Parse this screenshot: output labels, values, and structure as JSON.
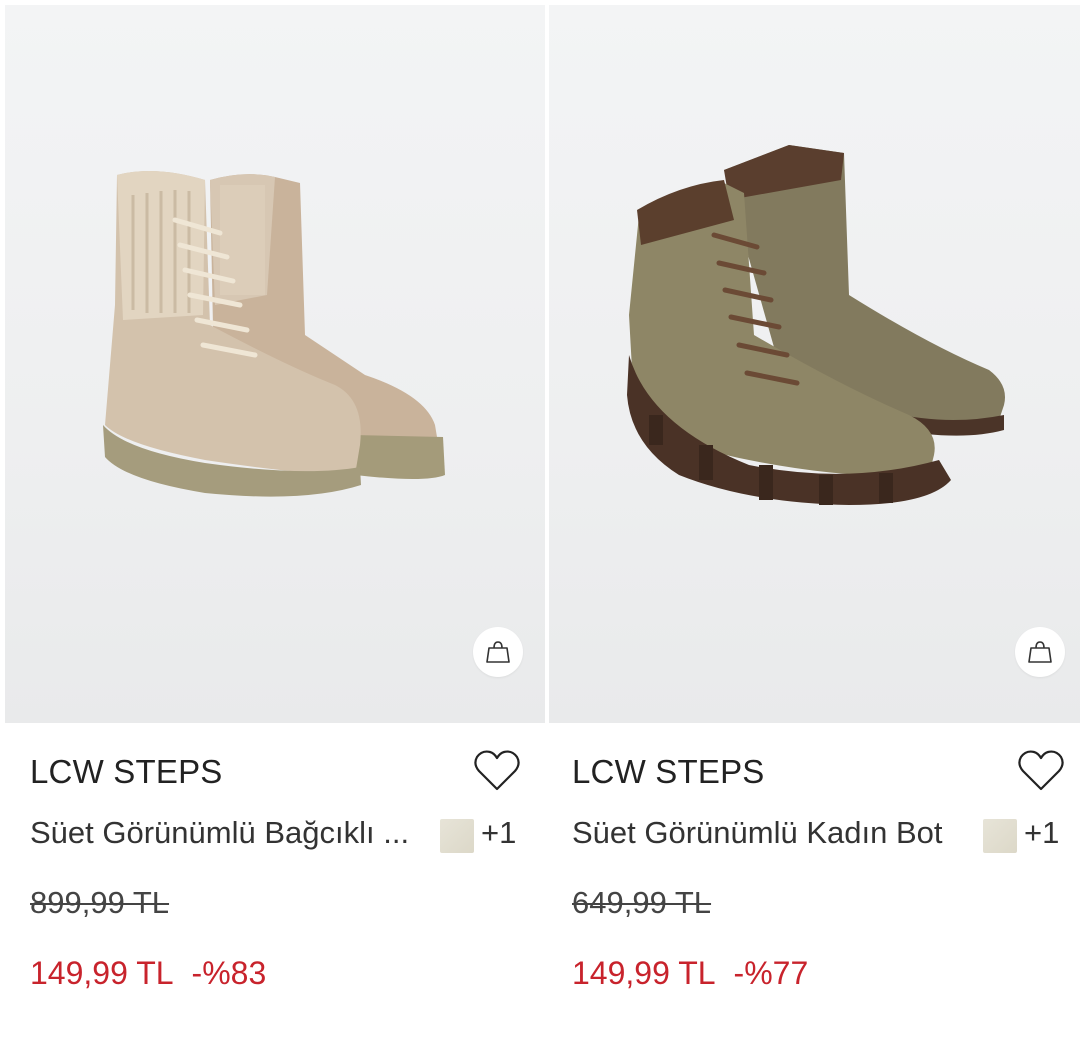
{
  "products": [
    {
      "brand": "LCW STEPS",
      "name": "Süet Görünümlü Bağcıklı ...",
      "more_colors": "+1",
      "old_price": "899,99 TL",
      "new_price": "149,99 TL",
      "discount": "-%83",
      "image_icon": "beige-boots-image"
    },
    {
      "brand": "LCW STEPS",
      "name": "Süet Görünümlü Kadın Bot",
      "more_colors": "+1",
      "old_price": "649,99 TL",
      "new_price": "149,99 TL",
      "discount": "-%77",
      "image_icon": "khaki-boots-image"
    }
  ],
  "colors": {
    "sale_red": "#c8232c",
    "text_dark": "#222222",
    "image_bg": "#eeeff0"
  }
}
